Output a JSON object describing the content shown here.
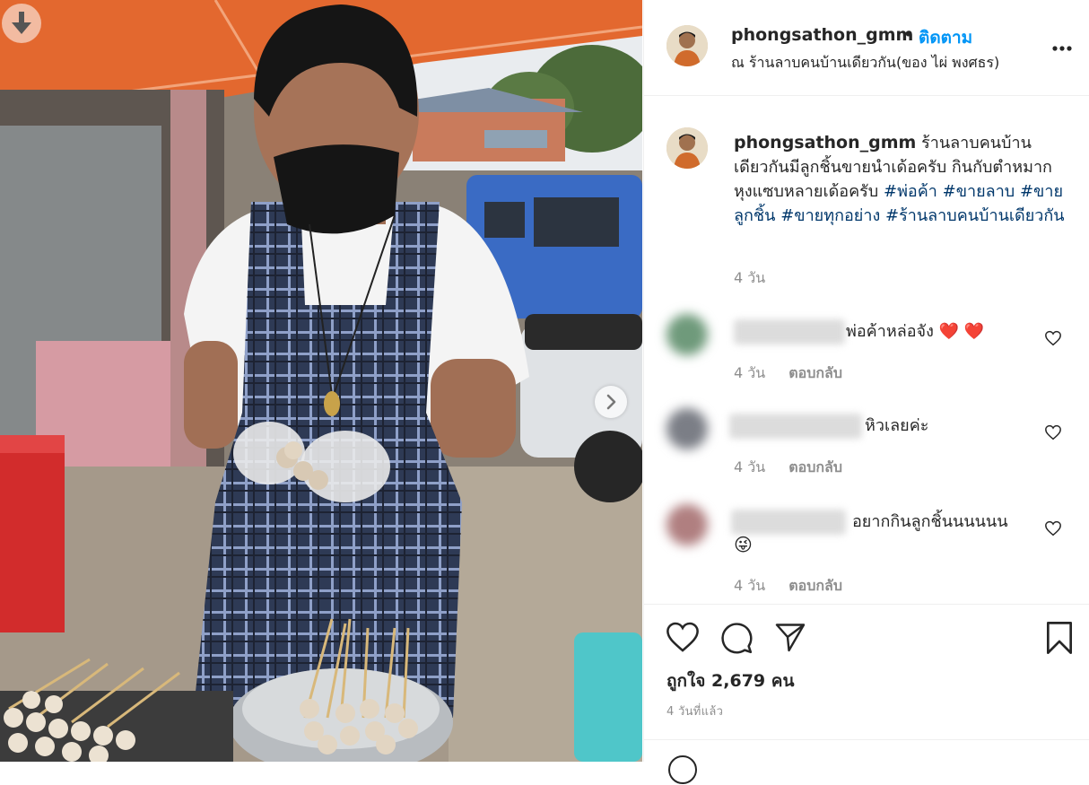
{
  "post": {
    "username": "phongsathon_gmm",
    "dot": "•",
    "follow_label": "ติดตาม",
    "location": "ณ ร้านลาบคนบ้านเดียวกัน(ของ ไผ่ พงศธร)",
    "caption_text": "ร้านลาบคนบ้านเดียวกันมีลูกชิ้นขายนำเด้อครับ กินกับตำหมากหุงแซบหลายเด้อครับ",
    "hashtags": [
      "#พ่อค้า",
      "#ขายลาบ",
      "#ขายลูกชิ้น",
      "#ขายทุกอย่าง",
      "#ร้านลาบคนบ้านเดียวกัน"
    ],
    "caption_time": "4 วัน",
    "likes_text": "ถูกใจ 2,679 คน",
    "posted_ago": "4 วันที่แล้ว"
  },
  "comments": [
    {
      "text": "พ่อค้าหล่อจัง",
      "emoji": "❤️ ❤️",
      "time": "4 วัน",
      "reply": "ตอบกลับ"
    },
    {
      "text": "หิวเลยค่ะ",
      "emoji": "",
      "time": "4 วัน",
      "reply": "ตอบกลับ"
    },
    {
      "text": "อยากกินลูกชิ้นนนนนน",
      "emoji": "😜",
      "time": "4 วัน",
      "reply": "ตอบกลับ"
    }
  ],
  "icons": {
    "download": "download-arrow-icon",
    "next": "chevron-right-icon",
    "more": "more-options-icon",
    "like": "heart-icon",
    "comment": "speech-bubble-icon",
    "share": "paper-plane-icon",
    "save": "bookmark-icon"
  },
  "colors": {
    "follow": "#0095f6",
    "hashtag": "#00376b",
    "muted": "#8e8e8e",
    "heart_red": "#ed4956"
  }
}
